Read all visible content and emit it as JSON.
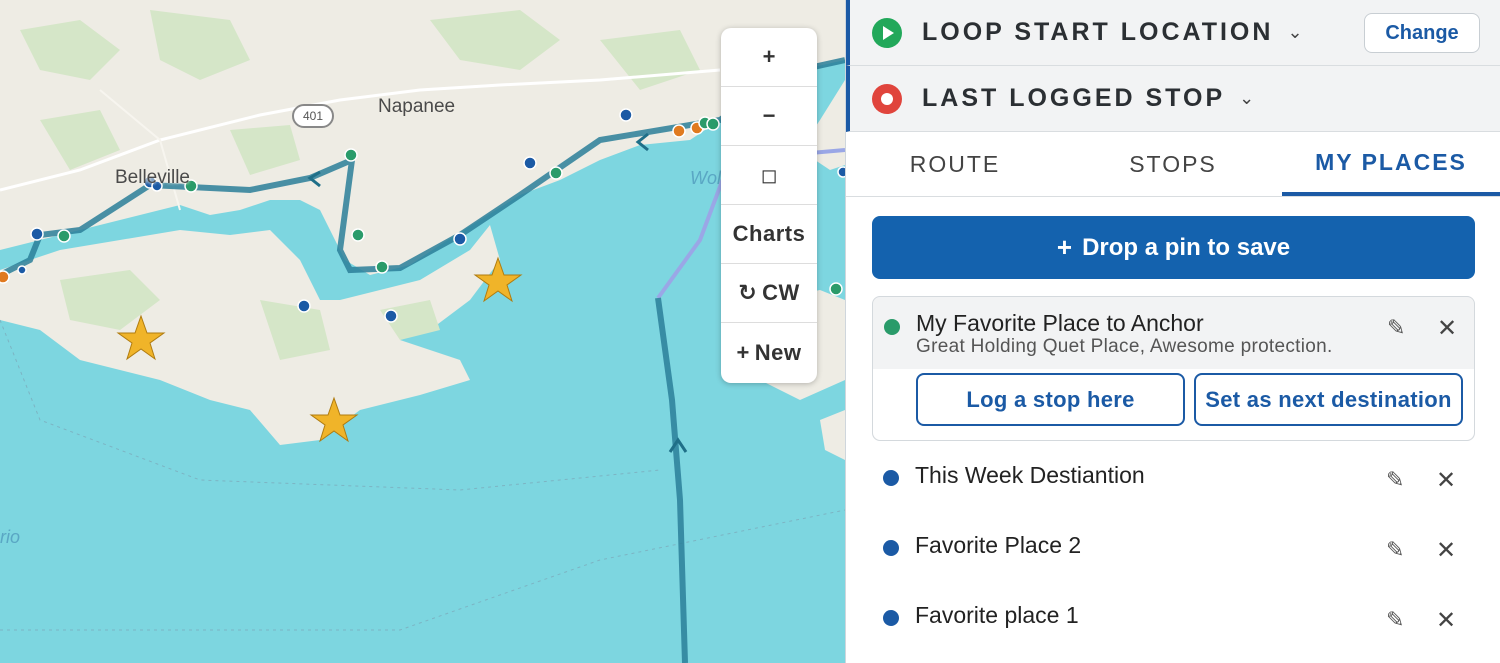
{
  "map": {
    "cities": [
      {
        "name": "Napanee"
      },
      {
        "name": "Belleville"
      }
    ],
    "water_labels": [
      "Wol",
      "rio"
    ],
    "highway_shield": "401",
    "controls": {
      "zoom_in": "+",
      "zoom_out": "−",
      "fit": "◻",
      "charts": "Charts",
      "cw_icon": "↻",
      "cw": "CW",
      "new_icon": "+",
      "new": "New"
    },
    "colors": {
      "water": "#7dd6e0",
      "land": "#eeece4",
      "route": "#2a7f99",
      "star": "#f0b429"
    }
  },
  "panel": {
    "start": {
      "title": "LOOP START LOCATION",
      "chevron": "⌄",
      "change_label": "Change",
      "icon": "play-icon",
      "color": "#22a85a"
    },
    "last_stop": {
      "title": "LAST LOGGED STOP",
      "chevron": "⌄",
      "icon": "record-icon",
      "color": "#e0443c"
    },
    "tabs": [
      {
        "label": "ROUTE",
        "active": false
      },
      {
        "label": "STOPS",
        "active": false
      },
      {
        "label": "MY PLACES",
        "active": true
      }
    ],
    "drop_pin": {
      "icon": "+",
      "label": "Drop a pin to save"
    },
    "places": [
      {
        "name": "My Favorite Place to Anchor",
        "description": "Great Holding Quet Place, Awesome protection.",
        "color": "#2a9b6a",
        "expanded": true,
        "log_label": "Log a stop here",
        "next_label": "Set as next destination"
      },
      {
        "name": "This Week Destiantion",
        "color": "#1b5aa5"
      },
      {
        "name": "Favorite Place 2",
        "color": "#1b5aa5"
      },
      {
        "name": "Favorite place 1",
        "color": "#1b5aa5"
      }
    ],
    "edit_icon": "✎",
    "close_icon": "✕"
  }
}
